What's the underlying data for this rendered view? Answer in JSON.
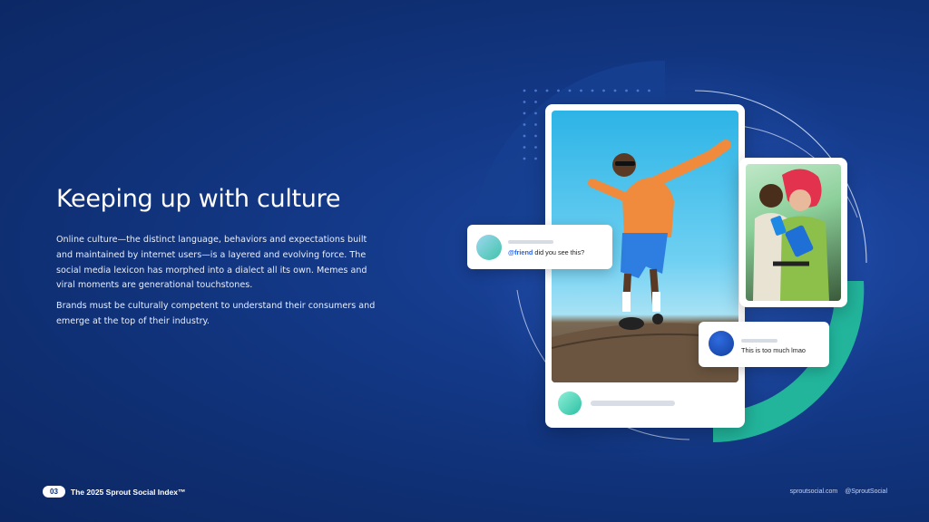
{
  "heading": "Keeping up with culture",
  "paragraphs": [
    "Online culture—the distinct language, behaviors and expectations built and maintained by internet users—is a layered and evolving force. The social media lexicon has morphed into a dialect all its own. Memes and viral moments are generational touchstones.",
    "Brands must be culturally competent to understand their consumers and emerge at the top of their industry."
  ],
  "comment_1": {
    "mention": "@friend",
    "text": " did you see this?"
  },
  "comment_2": {
    "text": "This is too much lmao"
  },
  "footer": {
    "page_number": "03",
    "report_title": "The 2025 Sprout Social Index™",
    "site": "sproutsocial.com",
    "handle": "@SproutSocial"
  },
  "colors": {
    "background": "#143a8a",
    "accent_teal": "#22b59c",
    "mention_blue": "#2563eb"
  }
}
